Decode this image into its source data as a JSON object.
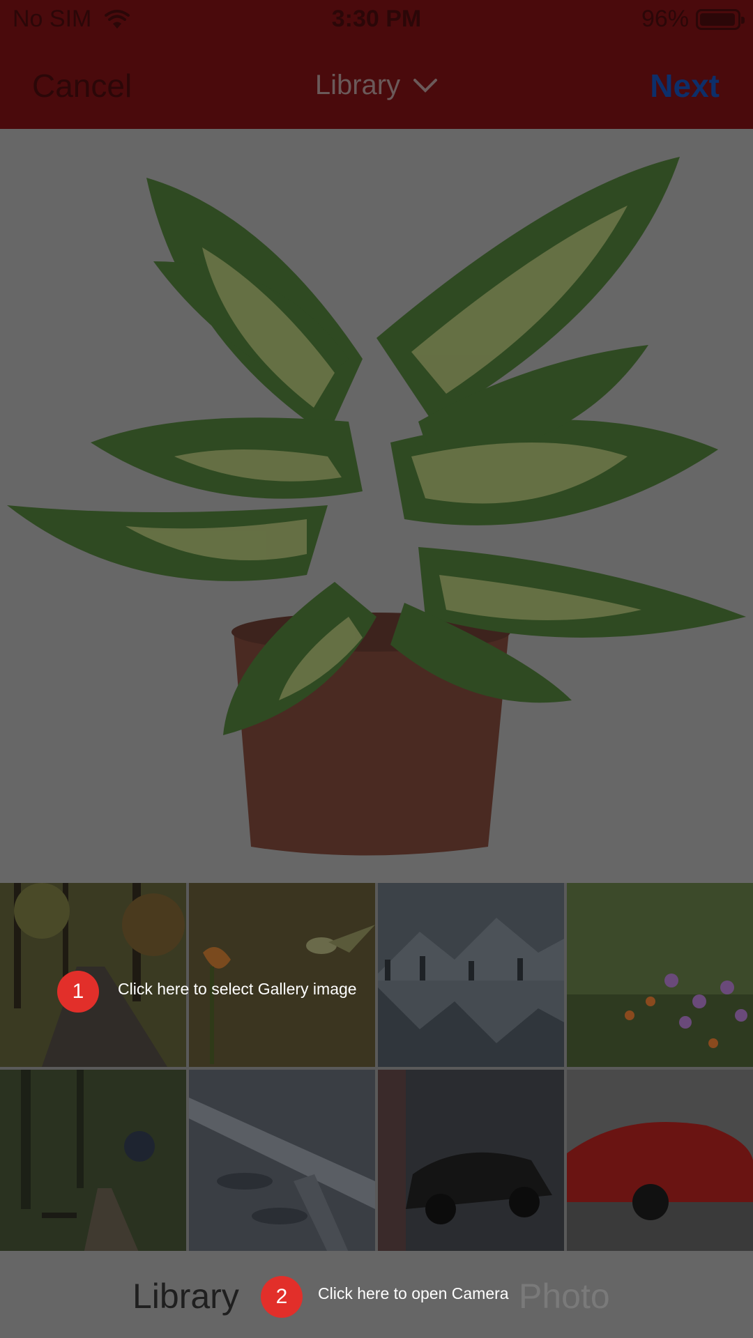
{
  "status_bar": {
    "carrier": "No SIM",
    "time": "3:30 PM",
    "battery": "96%",
    "battery_level": 0.96
  },
  "nav": {
    "cancel_label": "Cancel",
    "title": "Library",
    "next_label": "Next"
  },
  "gallery": {
    "thumbnails": [
      "forest-path",
      "hummingbird",
      "mountain-lake",
      "wildflowers",
      "park-bench",
      "airplane-wing",
      "black-sports-car",
      "red-sports-car"
    ]
  },
  "bottom_tabs": {
    "library_label": "Library",
    "photo_label": "Photo"
  },
  "tooltips": [
    {
      "number": "1",
      "text": "Click here to select Gallery image"
    },
    {
      "number": "2",
      "text": "Click here to open Camera"
    }
  ],
  "colors": {
    "accent_red": "#e22f2a",
    "nav_bar": "#4a0a0c",
    "next_blue": "#0d2f6a"
  }
}
